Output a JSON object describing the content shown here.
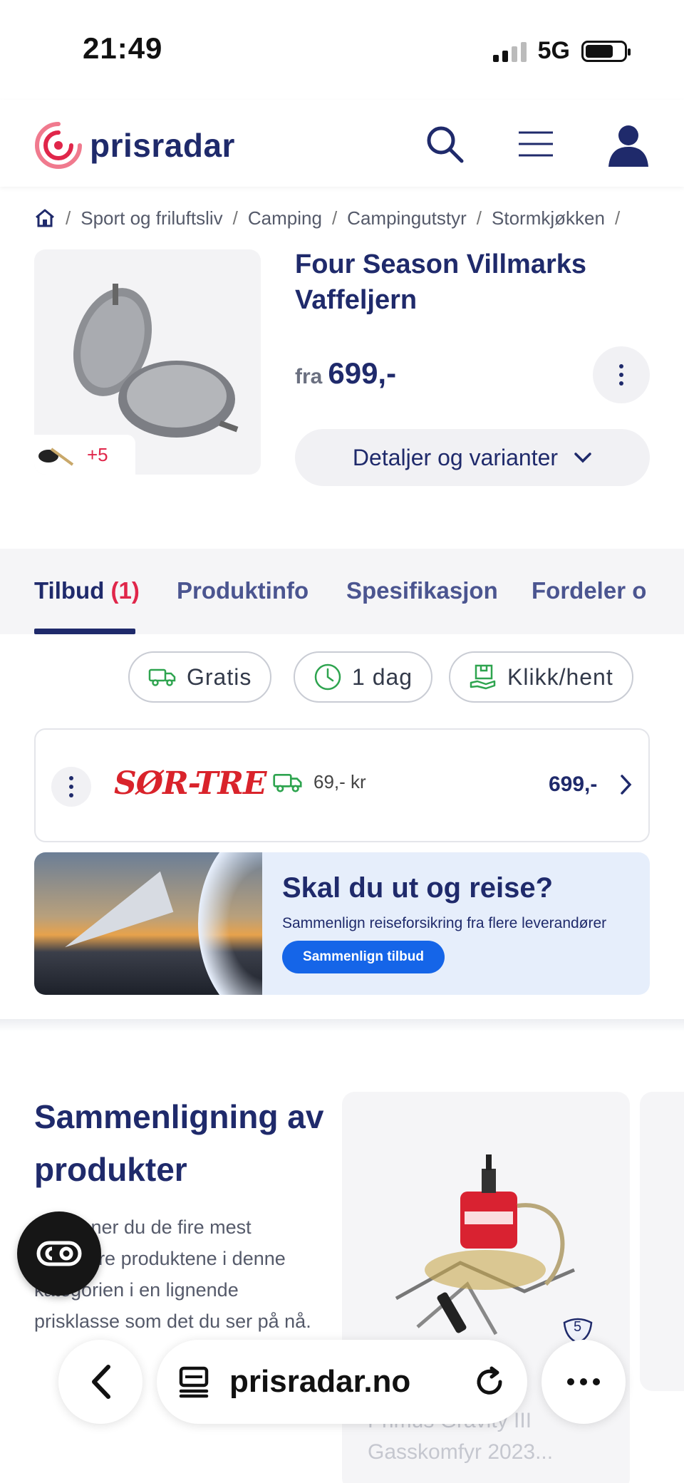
{
  "status_bar": {
    "time": "21:49",
    "network": "5G"
  },
  "header": {
    "logo_text": "prisradar",
    "icons": [
      "search-icon",
      "menu-icon",
      "user-icon"
    ]
  },
  "breadcrumb": [
    "Sport og friluftsliv",
    "Camping",
    "Campingutstyr",
    "Stormkjøkken"
  ],
  "product": {
    "title": "Four Season Villmarks Vaffeljern",
    "price_prefix": "fra",
    "price": "699,-",
    "more_images": "+5",
    "details_button": "Detaljer og varianter"
  },
  "tabs": [
    {
      "label": "Tilbud",
      "count": "(1)",
      "active": true
    },
    {
      "label": "Produktinfo"
    },
    {
      "label": "Spesifikasjon"
    },
    {
      "label": "Fordeler o"
    }
  ],
  "filters": [
    {
      "label": "Gratis",
      "icon": "truck-icon"
    },
    {
      "label": "1 dag",
      "icon": "clock-icon"
    },
    {
      "label": "Klikk/hent",
      "icon": "store-pickup-icon"
    }
  ],
  "offer": {
    "store": "SØR-TRE",
    "shipping": "69,- kr",
    "price": "699,-"
  },
  "banner": {
    "title": "Skal du ut og reise?",
    "subtitle": "Sammenlign reiseforsikring fra flere leverandører",
    "button": "Sammenlign tilbud"
  },
  "compare": {
    "title": "Sammenligning av produkter",
    "text": "Her finner du de fire mest populære produktene i denne kategorien i en lignende prisklasse som det du ser på nå.",
    "card_name": "Primus Gravity III Gasskomfyr 2023...",
    "card_badge": "5"
  },
  "browser": {
    "url": "prisradar.no"
  },
  "colors": {
    "navy": "#1f2a6b",
    "accent_red": "#e0264a",
    "green": "#2ea44f",
    "banner_blue": "#1565e8"
  }
}
